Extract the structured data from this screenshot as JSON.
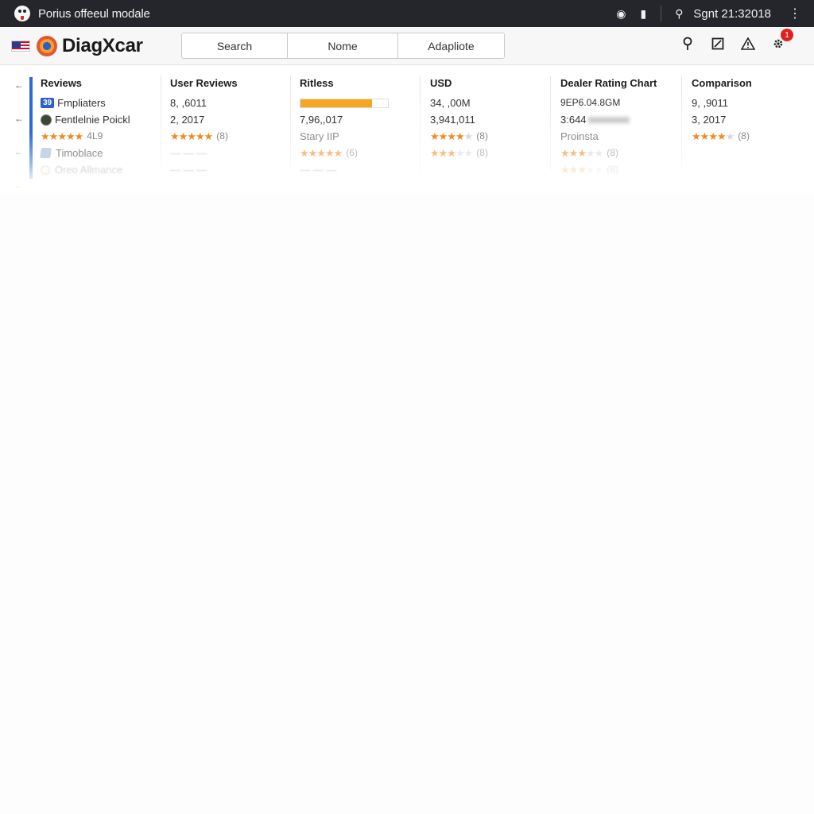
{
  "titlebar": {
    "title": "Porius offeeul modale",
    "clock": "Sgnt 21:32018",
    "icons": [
      "app-icon",
      "record-icon",
      "lock-icon",
      "search-icon",
      "more-vertical-icon"
    ]
  },
  "header": {
    "brand": "DiagXcar",
    "segments": [
      "Search",
      "Nome",
      "Adapliote"
    ],
    "icons": [
      "location-pin-icon",
      "edit-icon",
      "warning-icon",
      "settings-icon"
    ],
    "notification_count": "1"
  },
  "rail": {
    "arrows": [
      "←",
      "←",
      "←",
      "←"
    ]
  },
  "columns": [
    {
      "header": "Reviews",
      "rows": [
        {
          "type": "badge",
          "badge": "39",
          "text": "Fmpliaters"
        },
        {
          "type": "icon",
          "text": "Fentlelnie Poickl"
        },
        {
          "type": "stars",
          "rating": 5,
          "count": "4L9"
        },
        {
          "type": "pencil",
          "text": "Timoblace"
        },
        {
          "type": "ring",
          "text": "Oreo Allmance"
        }
      ]
    },
    {
      "header": "User Reviews",
      "rows": [
        {
          "type": "text",
          "text": "8, ,6011"
        },
        {
          "type": "text",
          "text": "2, 2017"
        },
        {
          "type": "stars",
          "rating": 5,
          "count": "(8)"
        },
        {
          "type": "blur",
          "text": "— — —"
        },
        {
          "type": "blur",
          "text": "— — —"
        }
      ]
    },
    {
      "header": "Ritless",
      "progress": 0.82,
      "rows": [
        {
          "type": "text",
          "text": "7,96,,017"
        },
        {
          "type": "text",
          "text": "Stary IIP"
        },
        {
          "type": "stars",
          "rating": 5,
          "count": "(6)"
        },
        {
          "type": "blur",
          "text": "— — —"
        }
      ]
    },
    {
      "header": "USD",
      "rows": [
        {
          "type": "text",
          "text": "34, ,00M"
        },
        {
          "type": "text",
          "text": "3,941,011"
        },
        {
          "type": "stars",
          "rating": 4,
          "count": "(8)"
        },
        {
          "type": "stars",
          "rating": 3,
          "count": "(8)"
        }
      ]
    },
    {
      "header": "Dealer Rating Chart",
      "rows": [
        {
          "type": "text",
          "text": "9EP6.04.8GM"
        },
        {
          "type": "text",
          "text": "3:644"
        },
        {
          "type": "text",
          "text": "Proinsta"
        },
        {
          "type": "stars",
          "rating": 3,
          "count": "(8)"
        },
        {
          "type": "stars",
          "rating": 3,
          "count": "(8)"
        }
      ]
    },
    {
      "header": "Comparison",
      "rows": [
        {
          "type": "text",
          "text": "9, ,9011"
        },
        {
          "type": "text",
          "text": "3, 2017"
        },
        {
          "type": "stars",
          "rating": 4,
          "count": "(8)"
        }
      ]
    }
  ],
  "colors": {
    "titlebar": "#24262b",
    "accent": "#2d6bd3",
    "star": "#f08a24",
    "progress": "#f5a623",
    "badge": "#e02020"
  }
}
